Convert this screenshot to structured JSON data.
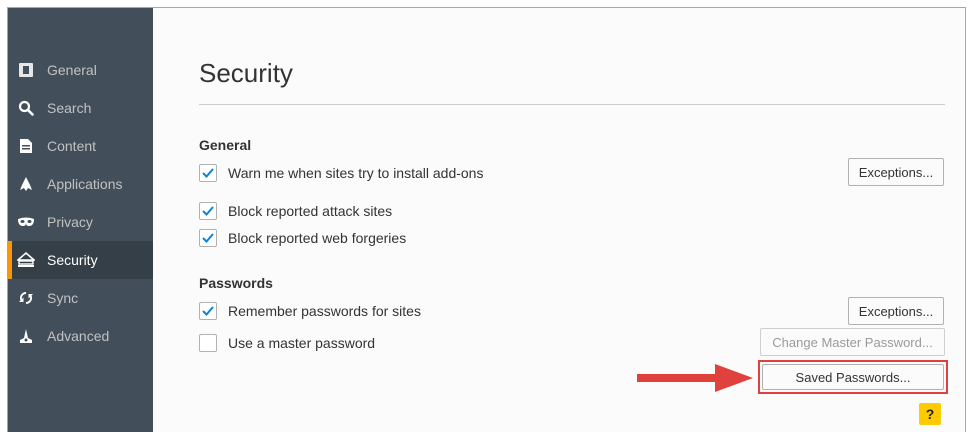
{
  "sidebar": {
    "items": [
      {
        "label": "General",
        "icon": "general-icon"
      },
      {
        "label": "Search",
        "icon": "search-icon"
      },
      {
        "label": "Content",
        "icon": "content-icon"
      },
      {
        "label": "Applications",
        "icon": "applications-icon"
      },
      {
        "label": "Privacy",
        "icon": "privacy-mask-icon"
      },
      {
        "label": "Security",
        "icon": "security-icon",
        "active": true
      },
      {
        "label": "Sync",
        "icon": "sync-icon"
      },
      {
        "label": "Advanced",
        "icon": "advanced-icon"
      }
    ]
  },
  "page": {
    "title": "Security",
    "general": {
      "heading": "General",
      "warn_addons": {
        "label": "Warn me when sites try to install add-ons",
        "checked": true
      },
      "block_attack": {
        "label": "Block reported attack sites",
        "checked": true
      },
      "block_forgeries": {
        "label": "Block reported web forgeries",
        "checked": true
      },
      "exceptions_button": "Exceptions..."
    },
    "passwords": {
      "heading": "Passwords",
      "remember": {
        "label": "Remember passwords for sites",
        "checked": true
      },
      "master": {
        "label": "Use a master password",
        "checked": false
      },
      "exceptions_button": "Exceptions...",
      "change_master_button": "Change Master Password...",
      "saved_passwords_button": "Saved Passwords..."
    },
    "help_button": "?"
  },
  "colors": {
    "sidebar_bg": "#424f5a",
    "active_indicator": "#ff9500",
    "checkbox_check": "#0a84d6",
    "annotation_red": "#e0413c",
    "help_bg": "#ffcb00"
  }
}
